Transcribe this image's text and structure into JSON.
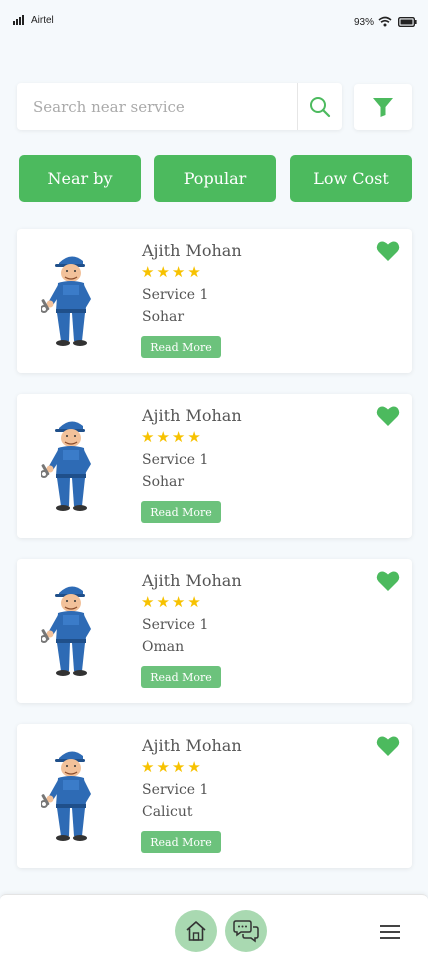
{
  "status_bar": {
    "carrier": "Airtel",
    "battery_percent": "93%"
  },
  "search": {
    "placeholder": "Search near service",
    "value": ""
  },
  "tabs": [
    {
      "label": "Near by"
    },
    {
      "label": "Popular"
    },
    {
      "label": "Low Cost"
    }
  ],
  "listings": [
    {
      "name": "Ajith Mohan",
      "rating": 4,
      "service": "Service 1",
      "location": "Sohar",
      "button": "Read More",
      "favorite": true
    },
    {
      "name": "Ajith Mohan",
      "rating": 4,
      "service": "Service 1",
      "location": "Sohar",
      "button": "Read More",
      "favorite": true
    },
    {
      "name": "Ajith Mohan",
      "rating": 4,
      "service": "Service 1",
      "location": "Oman",
      "button": "Read More",
      "favorite": true
    },
    {
      "name": "Ajith Mohan",
      "rating": 4,
      "service": "Service 1",
      "location": "Calicut",
      "button": "Read More",
      "favorite": true
    }
  ],
  "bottom_nav": {
    "items": [
      {
        "icon": "home-icon"
      },
      {
        "icon": "chat-icon"
      },
      {
        "icon": "menu-icon"
      }
    ]
  },
  "colors": {
    "accent": "#4cba5e",
    "read_more": "#6cc27c",
    "star": "#f7c200",
    "background": "#f5f9fc"
  }
}
